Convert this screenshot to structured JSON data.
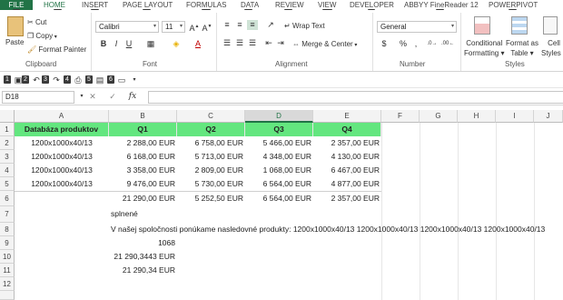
{
  "ribbon_tabs": [
    {
      "label": "FILE",
      "key": "F"
    },
    {
      "label": "HOME",
      "key": "H"
    },
    {
      "label": "INSERT",
      "key": "N"
    },
    {
      "label": "PAGE LAYOUT",
      "key": "P"
    },
    {
      "label": "FORMULAS",
      "key": "M"
    },
    {
      "label": "DATA",
      "key": "A"
    },
    {
      "label": "REVIEW",
      "key": "R"
    },
    {
      "label": "VIEW",
      "key": "W"
    },
    {
      "label": "DEVELOPER",
      "key": "L"
    },
    {
      "label": "ABBYY FineReader 12",
      "key": "Y"
    },
    {
      "label": "POWERPIVOT",
      "key": "B"
    }
  ],
  "clipboard": {
    "paste": "Paste",
    "cut": "Cut",
    "copy": "Copy",
    "format_painter": "Format Painter",
    "label": "Clipboard"
  },
  "font": {
    "name": "Calibri",
    "size": "11",
    "label": "Font"
  },
  "alignment": {
    "wrap_text": "Wrap Text",
    "merge_center": "Merge & Center",
    "label": "Alignment"
  },
  "number": {
    "format": "General",
    "label": "Number",
    "percent": "%",
    "comma": ","
  },
  "styles": {
    "conditional": "Conditional",
    "formatting": "Formatting",
    "format_as": "Format as",
    "table": "Table",
    "cell": "Cell",
    "cell_styles": "Styles",
    "label": "Styles"
  },
  "qat_keys": [
    "1",
    "2",
    "3",
    "4",
    "5",
    "6"
  ],
  "name_box": "D18",
  "fx_label": "fx",
  "columns": [
    "A",
    "B",
    "C",
    "D",
    "E",
    "F",
    "G",
    "H",
    "I",
    "J"
  ],
  "rows": [
    "1",
    "2",
    "3",
    "4",
    "5",
    "6",
    "7",
    "8",
    "9",
    "10",
    "11",
    "12"
  ],
  "header_row": [
    "Databáza produktov",
    "Q1",
    "Q2",
    "Q3",
    "Q4"
  ],
  "data_rows": [
    [
      "1200x1000x40/13",
      "2 288,00 EUR",
      "6 758,00 EUR",
      "5 466,00 EUR",
      "2 357,00 EUR"
    ],
    [
      "1200x1000x40/13",
      "6 168,00 EUR",
      "5 713,00 EUR",
      "4 348,00 EUR",
      "4 130,00 EUR"
    ],
    [
      "1200x1000x40/13",
      "3 358,00 EUR",
      "2 809,00 EUR",
      "1 068,00 EUR",
      "6 467,00 EUR"
    ],
    [
      "1200x1000x40/13",
      "9 476,00 EUR",
      "5 730,00 EUR",
      "6 564,00 EUR",
      "4 877,00 EUR"
    ]
  ],
  "totals_row": [
    "",
    "21 290,00 EUR",
    "5 252,50 EUR",
    "6 564,00 EUR",
    "2 357,00 EUR"
  ],
  "b7": "splnené",
  "b9": "V našej spoločnosti ponúkame nasledovné produkty: 1200x1000x40/13 1200x1000x40/13 1200x1000x40/13 1200x1000x40/13",
  "b10": "1068",
  "b11": "21 290,3443 EUR",
  "b12": "21 290,34 EUR",
  "colors": {
    "accent": "#217346",
    "header_fill": "#63e67f"
  }
}
